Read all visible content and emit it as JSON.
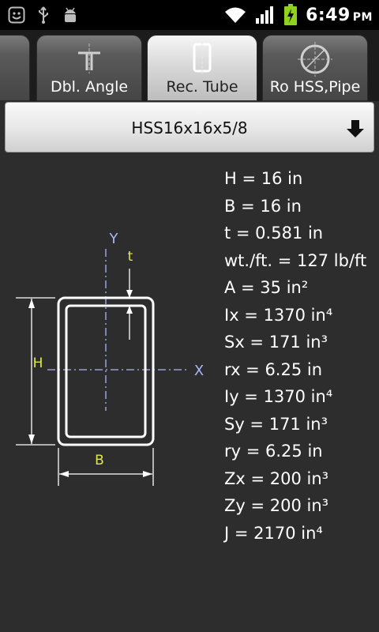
{
  "status_bar": {
    "time": "6:49",
    "ampm": "PM",
    "left_icons": [
      "smiley-icon",
      "usb-icon",
      "android-debug-icon"
    ],
    "right_icons": [
      "wifi-icon",
      "signal-icon",
      "battery-charging-icon"
    ],
    "accent_battery": "#8fd21e"
  },
  "tabs": [
    {
      "label": "",
      "icon": "partial-tab",
      "selected": false
    },
    {
      "label": "Dbl. Angle",
      "icon": "double-angle-icon",
      "selected": false
    },
    {
      "label": "Rec. Tube",
      "icon": "rect-tube-icon",
      "selected": true
    },
    {
      "label": "Ro HSS,Pipe",
      "icon": "round-pipe-icon",
      "selected": false
    }
  ],
  "section_dropdown": {
    "selected": "HSS16x16x5/8",
    "icon": "arrow-down-icon"
  },
  "diagram": {
    "labels": {
      "y_axis": "Y",
      "x_axis": "X",
      "thickness": "t",
      "height": "H",
      "width": "B"
    },
    "colors": {
      "axis": "#a9b7f5",
      "dimension": "#e0e84a",
      "outline": "#ffffff"
    }
  },
  "properties": [
    "H = 16 in",
    "B = 16 in",
    "t = 0.581 in",
    "wt./ft. = 127 lb/ft",
    "A = 35 in²",
    "Ix = 1370 in⁴",
    "Sx = 171 in³",
    "rx = 6.25 in",
    "Iy = 1370 in⁴",
    "Sy = 171 in³",
    "ry = 6.25 in",
    "Zx = 200 in³",
    "Zy = 200 in³",
    "J = 2170 in⁴"
  ]
}
